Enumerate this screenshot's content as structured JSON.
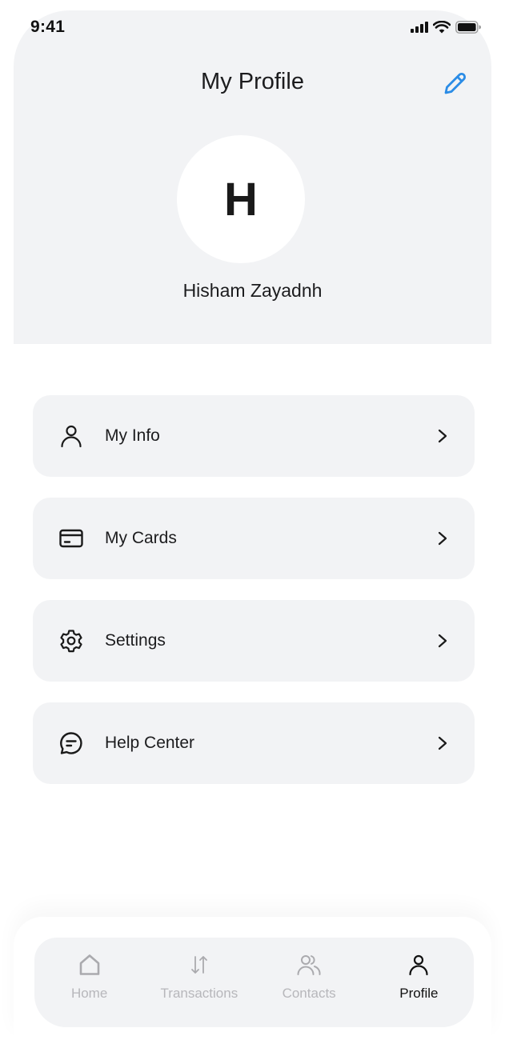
{
  "status_bar": {
    "time": "9:41",
    "icons": [
      "signal-icon",
      "wifi-icon",
      "battery-icon"
    ]
  },
  "header": {
    "title": "My Profile",
    "edit_icon": "pencil-icon",
    "accent_color": "#2b8ce6"
  },
  "profile": {
    "initial": "H",
    "name": "Hisham Zayadnh"
  },
  "menu": {
    "items": [
      {
        "label": "My Info",
        "icon": "user-icon"
      },
      {
        "label": "My Cards",
        "icon": "credit-card-icon"
      },
      {
        "label": "Settings",
        "icon": "gear-icon"
      },
      {
        "label": "Help Center",
        "icon": "chat-bubble-icon"
      }
    ],
    "chevron_icon": "chevron-right-icon"
  },
  "bottom_nav": {
    "items": [
      {
        "label": "Home",
        "icon": "home-icon",
        "active": false
      },
      {
        "label": "Transactions",
        "icon": "transfer-arrows-icon",
        "active": false
      },
      {
        "label": "Contacts",
        "icon": "contacts-icon",
        "active": false
      },
      {
        "label": "Profile",
        "icon": "user-icon",
        "active": true
      }
    ],
    "active_color": "#111111",
    "inactive_color": "#b7b7bb"
  }
}
